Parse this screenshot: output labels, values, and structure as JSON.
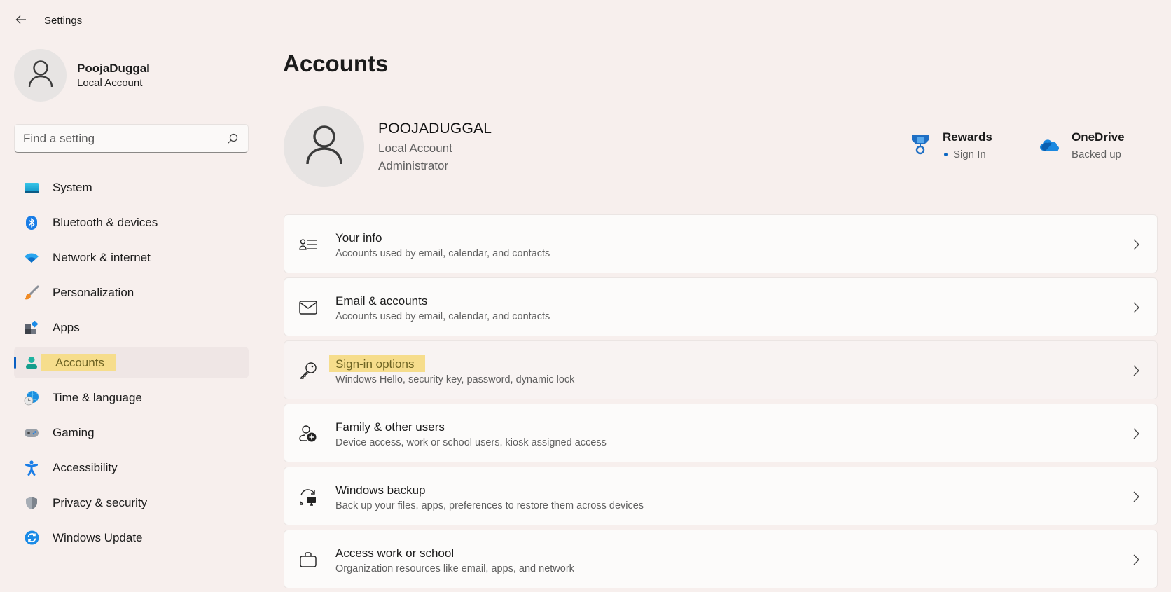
{
  "window": {
    "title": "Settings",
    "back_icon": "arrow-left-icon"
  },
  "sidebar": {
    "profile": {
      "name": "PoojaDuggal",
      "account_type": "Local Account",
      "avatar_icon": "person-icon"
    },
    "search": {
      "placeholder": "Find a setting",
      "value": "",
      "icon": "search-icon"
    },
    "items": [
      {
        "label": "System",
        "icon": "system-display-icon",
        "active": false
      },
      {
        "label": "Bluetooth & devices",
        "icon": "bluetooth-icon",
        "active": false
      },
      {
        "label": "Network & internet",
        "icon": "wifi-icon",
        "active": false
      },
      {
        "label": "Personalization",
        "icon": "paintbrush-icon",
        "active": false
      },
      {
        "label": "Apps",
        "icon": "apps-icon",
        "active": false
      },
      {
        "label": "Accounts",
        "icon": "accounts-person-icon",
        "active": true,
        "highlighted": true
      },
      {
        "label": "Time & language",
        "icon": "globe-clock-icon",
        "active": false
      },
      {
        "label": "Gaming",
        "icon": "gamepad-icon",
        "active": false
      },
      {
        "label": "Accessibility",
        "icon": "accessibility-icon",
        "active": false
      },
      {
        "label": "Privacy & security",
        "icon": "shield-icon",
        "active": false
      },
      {
        "label": "Windows Update",
        "icon": "update-sync-icon",
        "active": false
      }
    ]
  },
  "main": {
    "title": "Accounts",
    "user": {
      "name": "POOJADUGGAL",
      "account_type": "Local Account",
      "role": "Administrator"
    },
    "services": [
      {
        "title": "Rewards",
        "subtitle": "Sign In",
        "icon": "rewards-medal-icon",
        "dot": true
      },
      {
        "title": "OneDrive",
        "subtitle": "Backed up",
        "icon": "onedrive-cloud-icon",
        "dot": false
      }
    ],
    "cards": [
      {
        "title": "Your info",
        "description": "Accounts used by email, calendar, and contacts",
        "icon": "person-list-icon"
      },
      {
        "title": "Email & accounts",
        "description": "Accounts used by email, calendar, and contacts",
        "icon": "mail-icon"
      },
      {
        "title": "Sign-in options",
        "description": "Windows Hello, security key, password, dynamic lock",
        "icon": "key-icon",
        "highlighted": true
      },
      {
        "title": "Family & other users",
        "description": "Device access, work or school users, kiosk assigned access",
        "icon": "person-add-icon"
      },
      {
        "title": "Windows backup",
        "description": "Back up your files, apps, preferences to restore them across devices",
        "icon": "backup-sync-icon"
      },
      {
        "title": "Access work or school",
        "description": "Organization resources like email, apps, and network",
        "icon": "briefcase-icon"
      }
    ]
  },
  "colors": {
    "background": "#f7efed",
    "accent": "#0a5fc2",
    "highlight": "#f6dd8c"
  }
}
